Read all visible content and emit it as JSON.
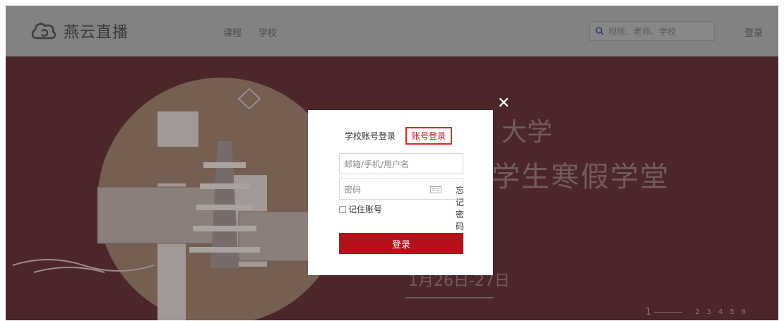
{
  "brand": {
    "name": "燕云直播"
  },
  "nav": {
    "items": [
      "课程",
      "学校"
    ]
  },
  "search": {
    "placeholder": "视频、老师、学校"
  },
  "header": {
    "login_label": "登录"
  },
  "banner": {
    "title_line1": "大学",
    "title_line2": "学生寒假学堂",
    "date_text": "1月26日-27日",
    "pager_active": "1",
    "pager_pages": [
      "2",
      "3",
      "4",
      "5",
      "6"
    ],
    "bg_color": "#56262a"
  },
  "modal": {
    "close_label": "✕",
    "tab_school": "学校账号登录",
    "tab_account": "账号登录",
    "username_placeholder": "邮箱/手机/用户名",
    "password_placeholder": "密码",
    "forgot_label": "忘记密码",
    "remember_label": "记住账号",
    "submit_label": "登录",
    "accent_color": "#b3121a"
  }
}
